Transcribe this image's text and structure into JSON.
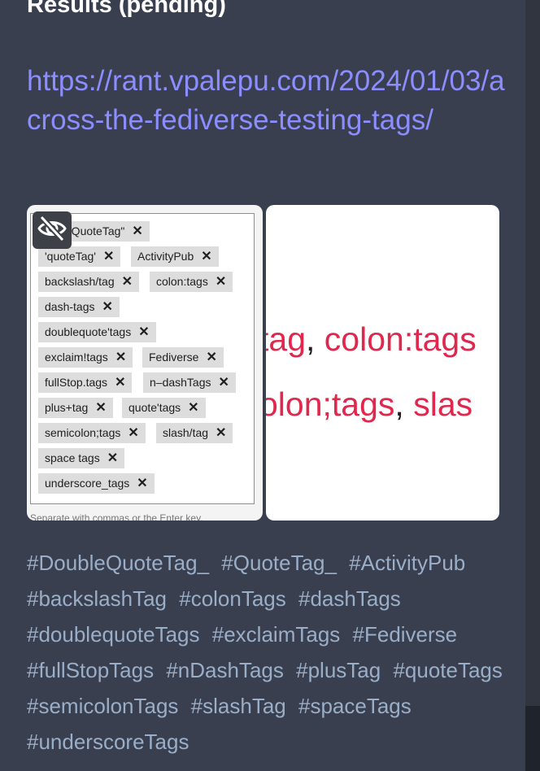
{
  "post": {
    "heading": "Results (pending)",
    "link": "https://rant.vpalepu.com/2024/01/03/across-the-fediverse-testing-tags/",
    "hide_media_icon": "eye-slash-icon",
    "hashtags": [
      "#DoubleQuoteTag_",
      "#QuoteTag_",
      "#ActivityPub",
      "#backslashTag",
      "#colonTags",
      "#dashTags",
      "#doublequoteTags",
      "#exclaimTags",
      "#Fediverse",
      "#fullStopTags",
      "#nDashTags",
      "#plusTag",
      "#quoteTags",
      "#semicolonTags",
      "#slashTag",
      "#spaceTags",
      "#underscoreTags"
    ]
  },
  "media_left": {
    "chips": [
      "…bleQuoteTag\"",
      "'quoteTag'",
      "ActivityPub",
      "backslash/tag",
      "colon:tags",
      "dash-tags",
      "doublequote'tags",
      "exclaim!tags",
      "Fediverse",
      "fullStop.tags",
      "n–dashTags",
      "plus+tag",
      "quote'tags",
      "semicolon;tags",
      "slash/tag",
      "space tags",
      "underscore_tags"
    ],
    "remove_glyph": "✕",
    "help_text": "Separate with commas or the Enter key."
  },
  "media_right": {
    "line1_part1": "tag",
    "line1_sep": ",",
    "line1_part2": " colon:tags",
    "line2_part1": "olon;tags",
    "line2_sep": ",",
    "line2_part2": " slas"
  },
  "colors": {
    "background": "#393f4f",
    "link": "#8c8dff",
    "hashtag": "#9baec8",
    "accent_red": "#e0274d"
  }
}
